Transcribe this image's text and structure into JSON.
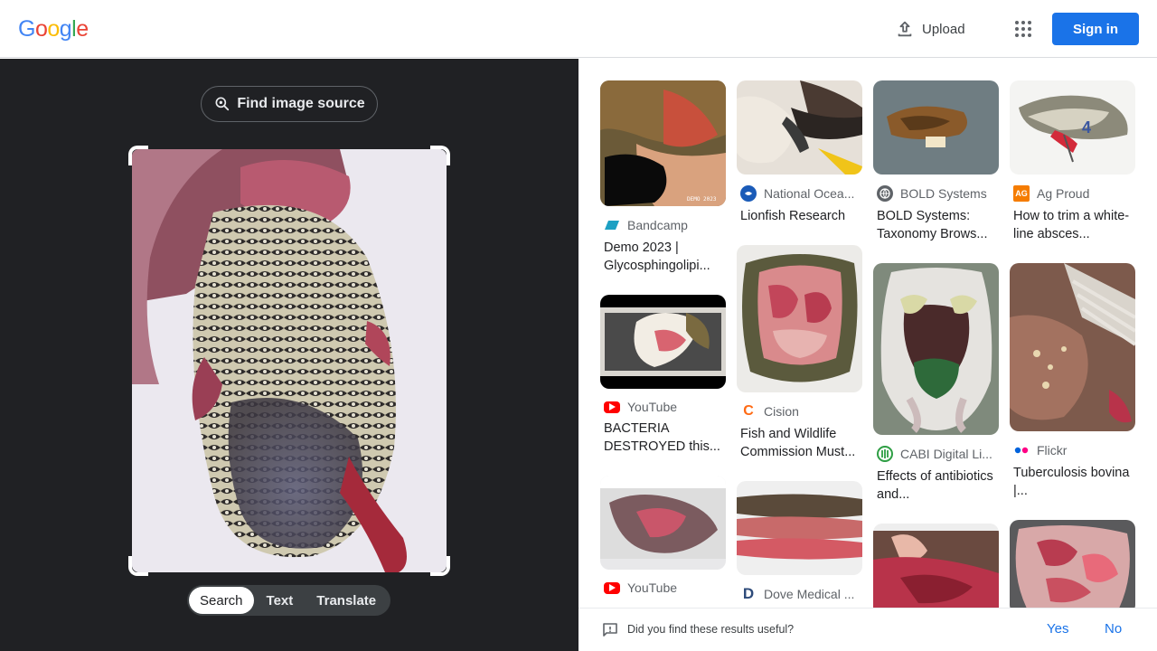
{
  "header": {
    "logo_letters": [
      "G",
      "o",
      "o",
      "g",
      "l",
      "e"
    ],
    "logo_colors": [
      "#4285F4",
      "#EA4335",
      "#FBBC05",
      "#4285F4",
      "#34A853",
      "#EA4335"
    ],
    "upload_label": "Upload",
    "apps_icon": "apps-grid-icon",
    "signin_label": "Sign in"
  },
  "query": {
    "find_source_label": "Find image source",
    "modes": [
      "Search",
      "Text",
      "Translate"
    ],
    "active_mode": "Search"
  },
  "results": {
    "columns": [
      [
        {
          "source": "Bandcamp",
          "title": "Demo 2023 | Glycosphingolipi...",
          "favicon": "bandcamp-icon",
          "fav_color": "#1da0c3",
          "thumb": "dissection-dark",
          "watermark": "DEMO 2023"
        },
        {
          "source": "YouTube",
          "title": "BACTERIA DESTROYED this...",
          "favicon": "youtube-icon",
          "fav_color": "#ff0000",
          "thumb": "video-fish"
        },
        {
          "source": "YouTube",
          "title": "",
          "favicon": "youtube-icon",
          "fav_color": "#ff0000",
          "thumb": "tray-specimen"
        }
      ],
      [
        {
          "source": "National Ocea...",
          "title": "Lionfish Research",
          "favicon": "noaa-icon",
          "fav_color": "#1a5bb8",
          "thumb": "gloved-hands"
        },
        {
          "source": "Cision",
          "title": "Fish and Wildlife Commission Must...",
          "favicon": "cision-icon",
          "fav_color": "#ff6a13",
          "thumb": "turtle-open"
        },
        {
          "source": "Dove Medical ...",
          "title": "",
          "favicon": "dove-icon",
          "fav_color": "#2e4b7a",
          "thumb": "tissue-strips"
        }
      ],
      [
        {
          "source": "BOLD Systems",
          "title": "BOLD Systems: Taxonomy Brows...",
          "favicon": "globe-icon",
          "fav_color": "#5f6368",
          "thumb": "specimen-table"
        },
        {
          "source": "CABI Digital Li...",
          "title": "Effects of antibiotics and...",
          "favicon": "cabi-icon",
          "fav_color": "#2e9e44",
          "thumb": "frog-dissection"
        },
        {
          "source": "",
          "title": "",
          "favicon": "",
          "fav_color": "#ffffff",
          "thumb": "hand-tissue"
        }
      ],
      [
        {
          "source": "Ag Proud",
          "title": "How to trim a white-line absces...",
          "favicon": "agproud-icon",
          "fav_color": "#f57c00",
          "thumb": "hoof-diagram",
          "overlay": "4"
        },
        {
          "source": "Flickr",
          "title": "Tuberculosis bovina |...",
          "favicon": "flickr-icon",
          "fav_color": "#0063dc",
          "thumb": "carcass-ribs"
        },
        {
          "source": "",
          "title": "",
          "favicon": "",
          "fav_color": "#ffffff",
          "thumb": "red-tissue-grid"
        }
      ]
    ]
  },
  "feedback": {
    "question": "Did you find these results useful?",
    "yes_label": "Yes",
    "no_label": "No"
  }
}
